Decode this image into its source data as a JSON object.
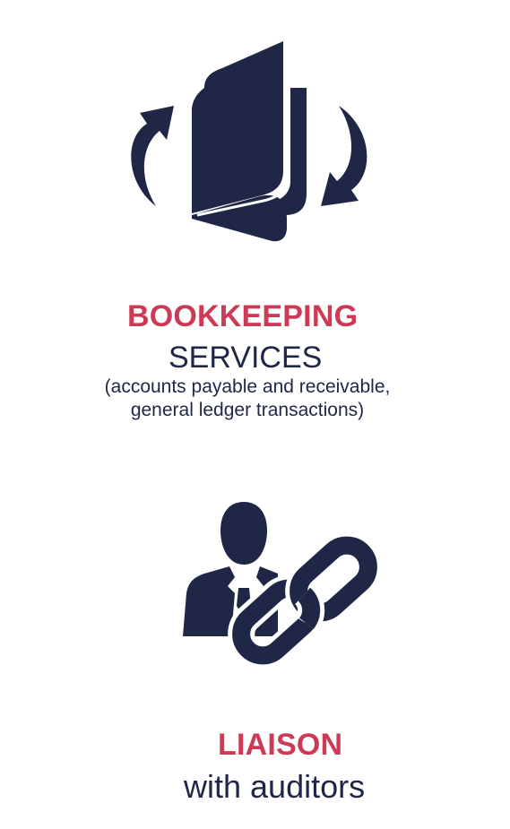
{
  "colors": {
    "accent": "#cd3a56",
    "navy": "#1f2646",
    "background": "#ffffff"
  },
  "services": [
    {
      "icon": "book-cycle-icon",
      "headline": "BOOKKEEPING",
      "subline": "SERVICES",
      "detail_lines": [
        "(accounts payable and receivable,",
        "general ledger transactions)"
      ]
    },
    {
      "icon": "person-link-icon",
      "headline": "LIAISON",
      "subline": "with auditors"
    }
  ]
}
